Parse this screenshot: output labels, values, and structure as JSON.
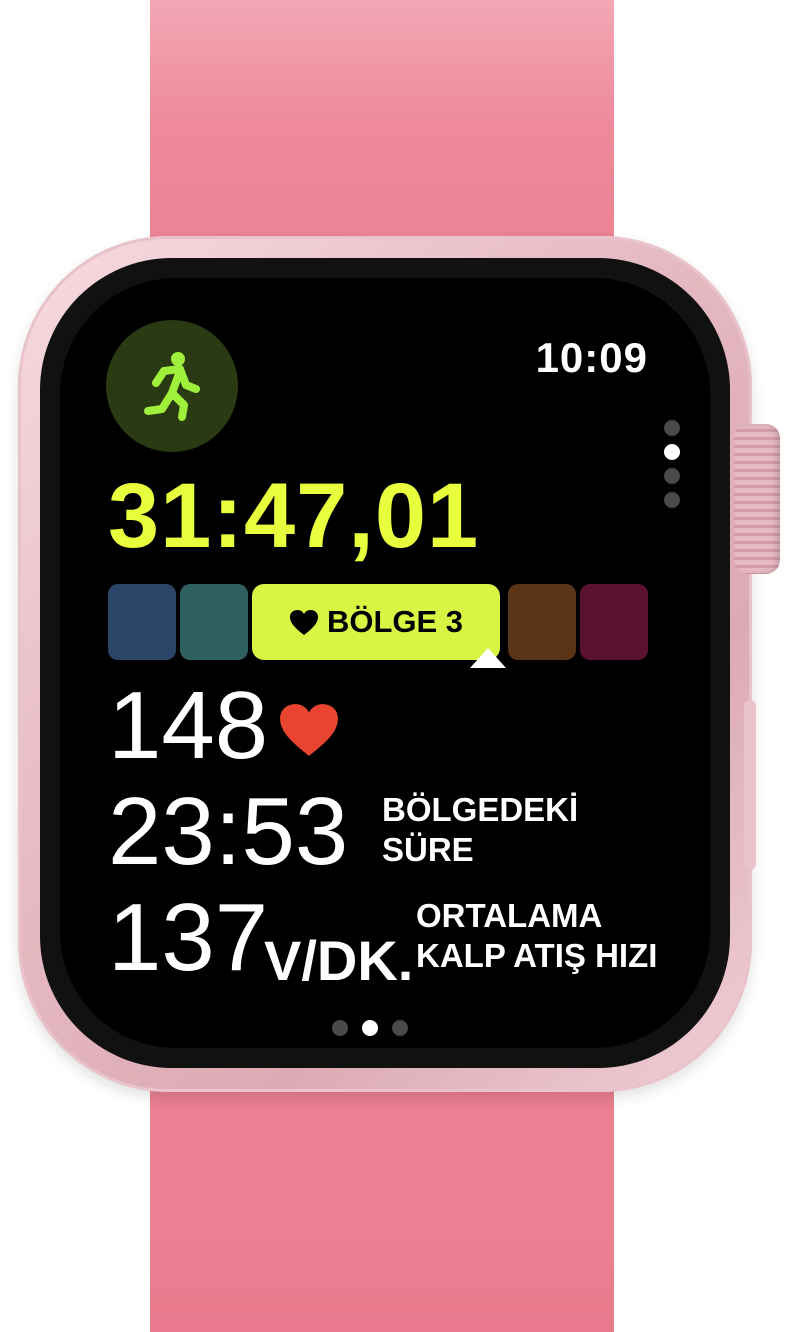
{
  "watch": {
    "band_color": "#ec8193",
    "case_color": "#e9bec6"
  },
  "status": {
    "time": "10:09",
    "activity_icon": "running-figure-icon",
    "activity_color": "#9ff03a"
  },
  "workout": {
    "elapsed_time": "31:47,01",
    "elapsed_color": "#e7ff3d",
    "zones": {
      "current_label": "BÖLGE 3",
      "current_icon": "heart-icon",
      "current_color": "#d8f544",
      "colors": [
        "#2b4566",
        "#2f5f5f",
        "#d8f544",
        "#5a3416",
        "#5a1230"
      ]
    },
    "heart_rate": {
      "value": "148",
      "icon": "heart-icon",
      "icon_color": "#e8442f"
    },
    "time_in_zone": {
      "value": "23:53",
      "label_line1": "BÖLGEDEKİ",
      "label_line2": "SÜRE"
    },
    "average_hr": {
      "value": "137",
      "unit": "V/DK.",
      "label_line1": "ORTALAMA",
      "label_line2": "KALP ATIŞ HIZI"
    }
  },
  "pagination": {
    "vertical_count": 4,
    "vertical_active": 1,
    "horizontal_count": 3,
    "horizontal_active": 1
  }
}
